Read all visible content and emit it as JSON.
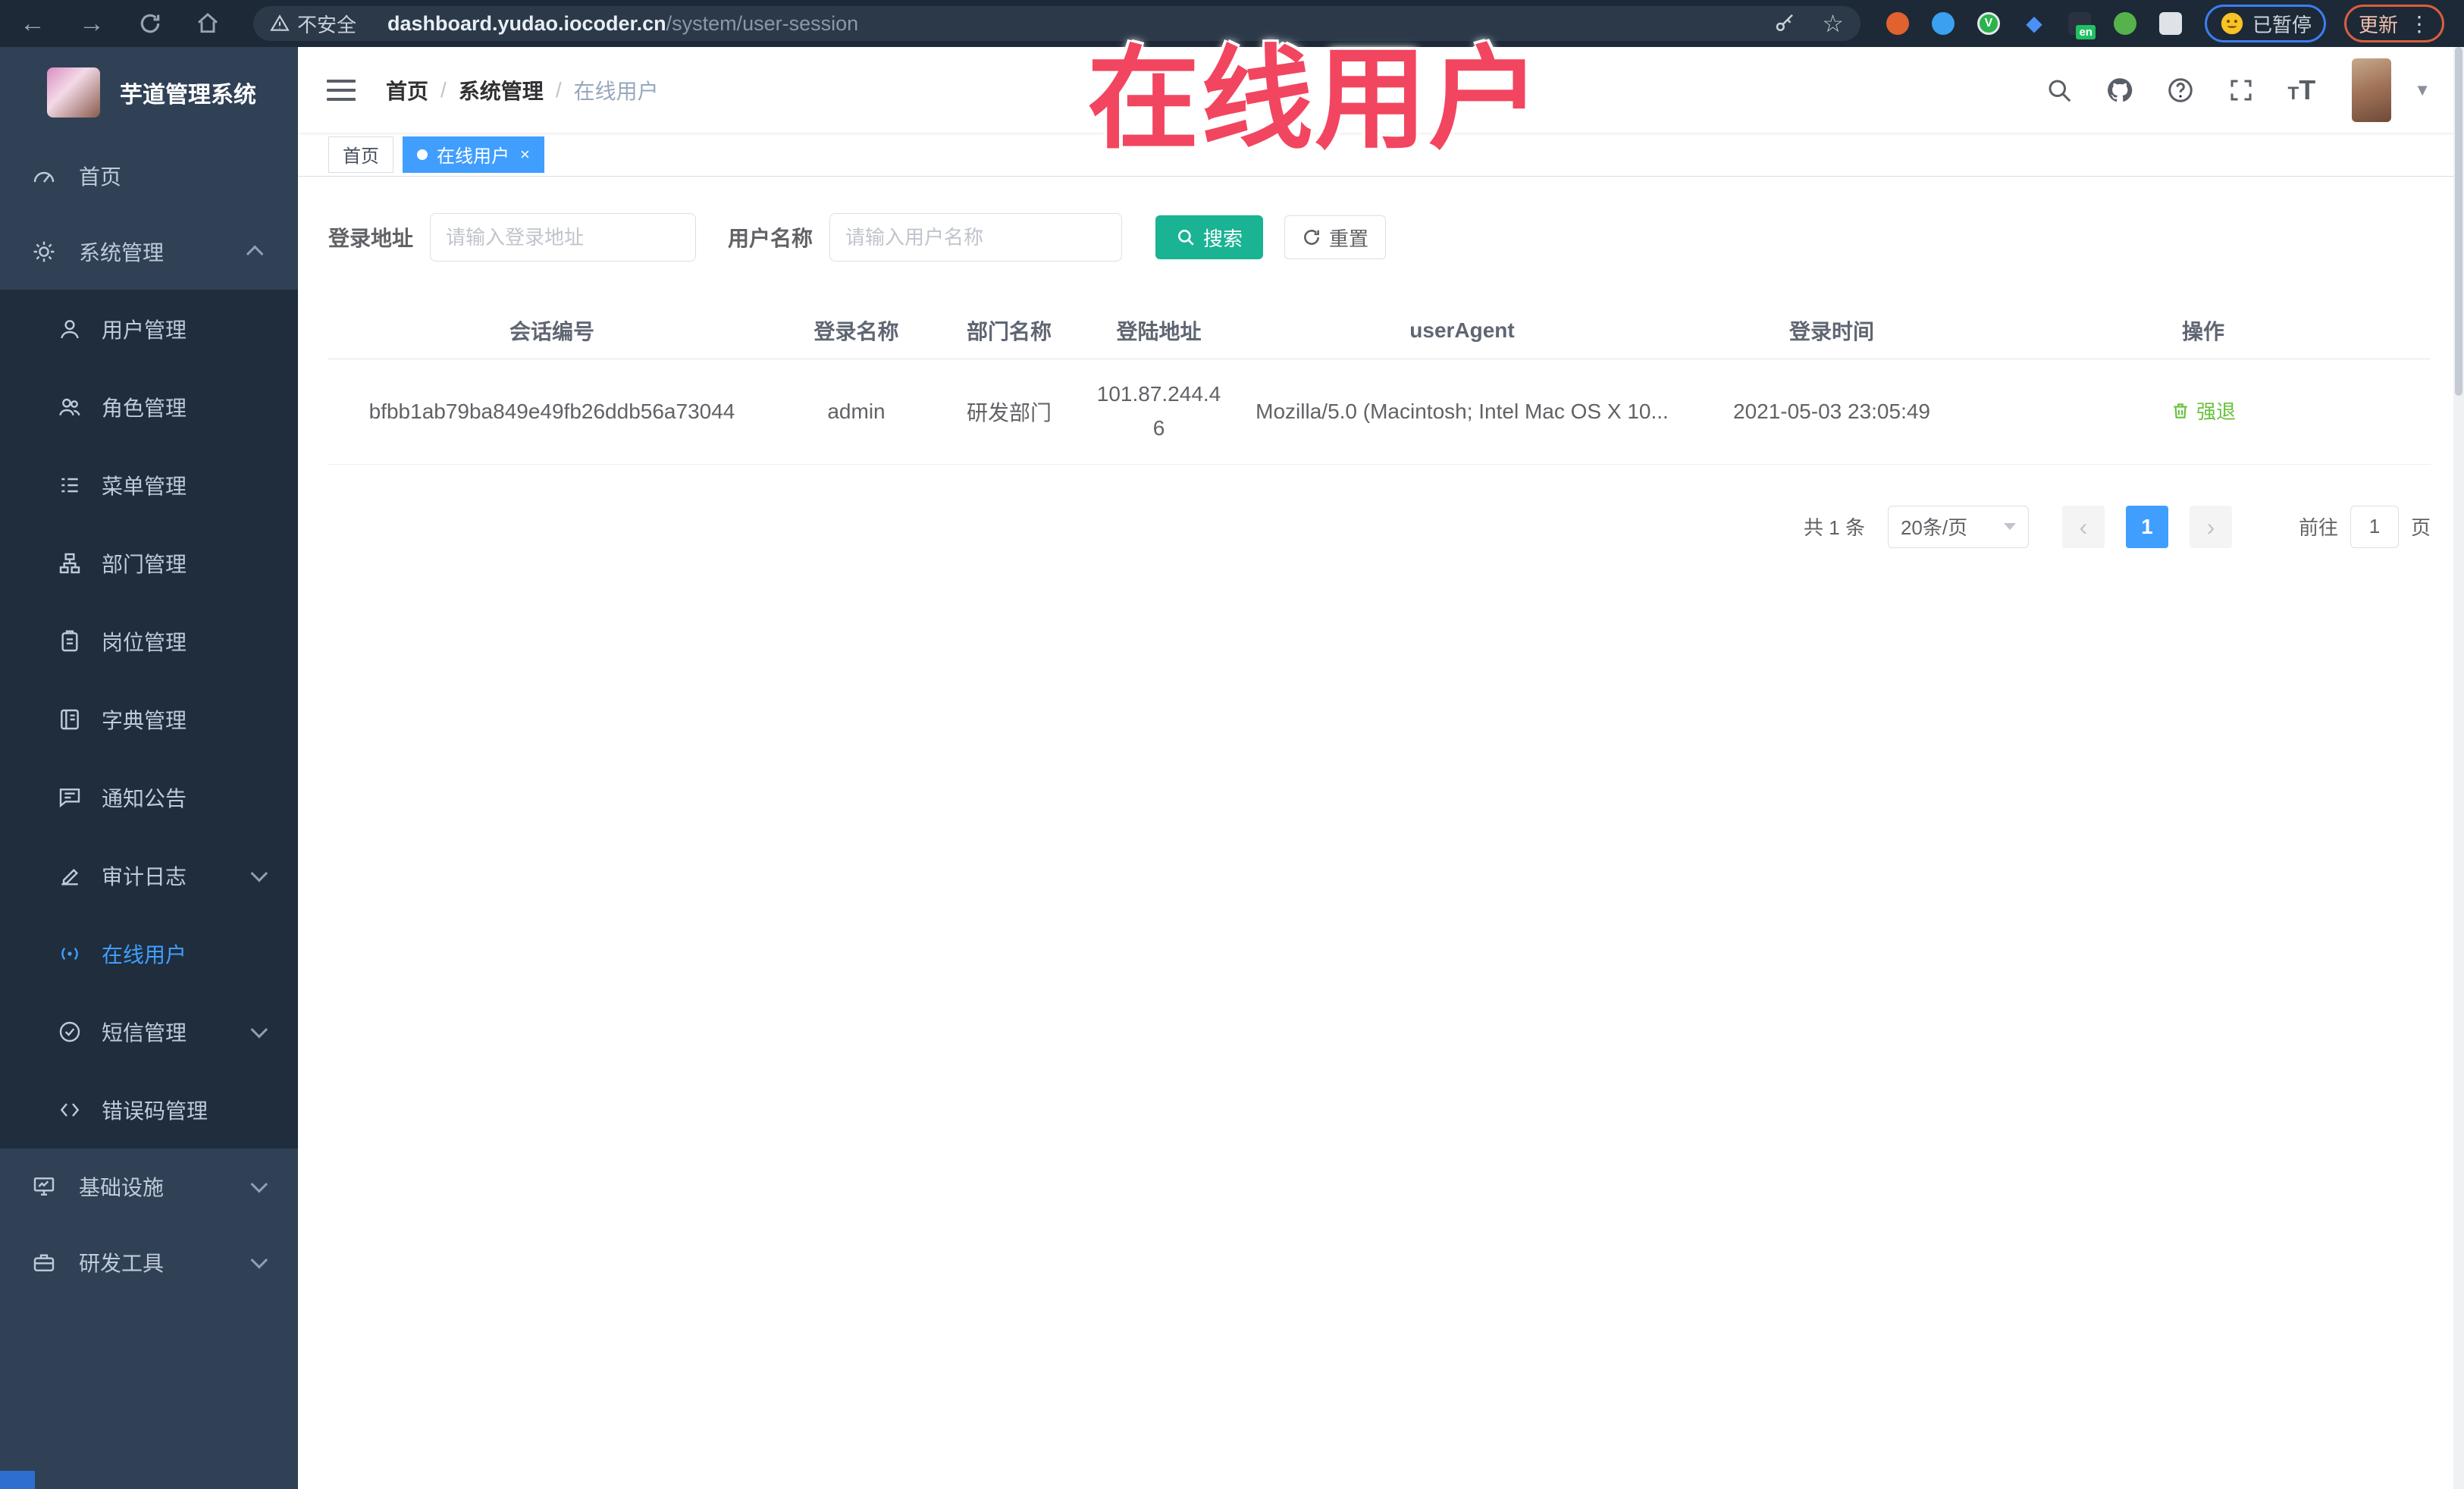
{
  "browser": {
    "security_label": "不安全",
    "url_host": "dashboard.yudao.iocoder.cn",
    "url_path": "/system/user-session",
    "translate_badge": "en",
    "paused_label": "已暂停",
    "update_label": "更新"
  },
  "annotation": {
    "text": "在线用户"
  },
  "sidebar": {
    "title": "芋道管理系统",
    "items": [
      {
        "label": "首页"
      },
      {
        "label": "系统管理"
      },
      {
        "label": "用户管理"
      },
      {
        "label": "角色管理"
      },
      {
        "label": "菜单管理"
      },
      {
        "label": "部门管理"
      },
      {
        "label": "岗位管理"
      },
      {
        "label": "字典管理"
      },
      {
        "label": "通知公告"
      },
      {
        "label": "审计日志"
      },
      {
        "label": "在线用户"
      },
      {
        "label": "短信管理"
      },
      {
        "label": "错误码管理"
      },
      {
        "label": "基础设施"
      },
      {
        "label": "研发工具"
      }
    ]
  },
  "breadcrumb": {
    "items": [
      "首页",
      "系统管理",
      "在线用户"
    ]
  },
  "tabs": {
    "home": "首页",
    "current": "在线用户"
  },
  "filters": {
    "address_label": "登录地址",
    "address_placeholder": "请输入登录地址",
    "name_label": "用户名称",
    "name_placeholder": "请输入用户名称",
    "search": "搜索",
    "reset": "重置"
  },
  "table": {
    "headers": [
      "会话编号",
      "登录名称",
      "部门名称",
      "登陆地址",
      "userAgent",
      "登录时间",
      "操作"
    ],
    "row": {
      "session_id": "bfbb1ab79ba849e49fb26ddb56a73044",
      "username": "admin",
      "dept": "研发部门",
      "ip": "101.87.244.46",
      "user_agent": "Mozilla/5.0 (Macintosh; Intel Mac OS X 10...",
      "login_time": "2021-05-03 23:05:49",
      "action": "强退"
    }
  },
  "pagination": {
    "total": "共 1 条",
    "page_size": "20条/页",
    "prev": "‹",
    "page": "1",
    "next": "›",
    "goto_label": "前往",
    "goto_value": "1",
    "unit": "页"
  },
  "colors": {
    "accent": "#409eff",
    "search_button": "#1ab394",
    "action_link": "#67c23a",
    "annotation": "#f2455f",
    "sidebar_bg": "#304156",
    "submenu_bg": "#1f2d3d"
  }
}
